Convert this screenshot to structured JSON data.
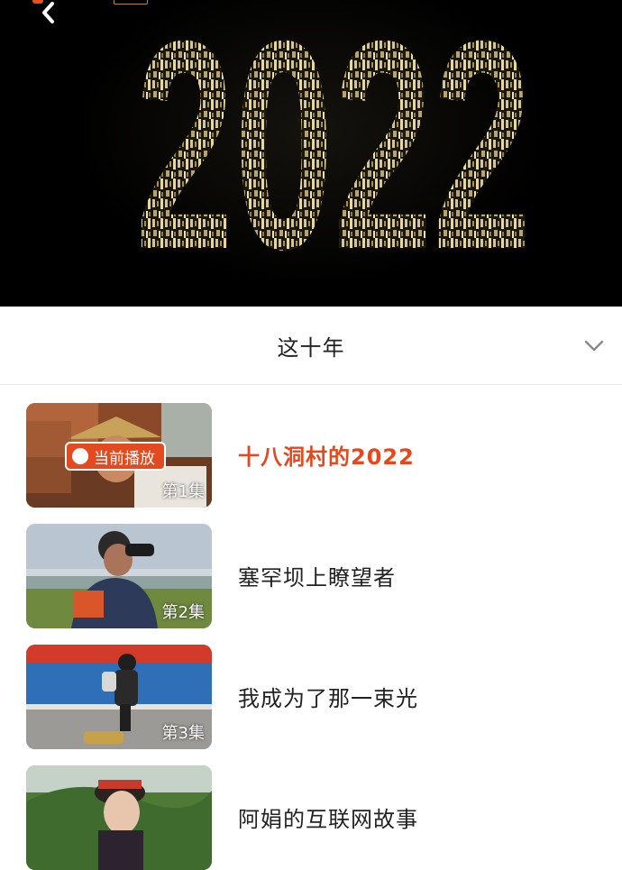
{
  "hero": {
    "year_text": "2022"
  },
  "section": {
    "title": "这十年"
  },
  "episodes": [
    {
      "thumb_label": "第1集",
      "title": "十八洞村的2022",
      "active": true,
      "badge": "当前播放"
    },
    {
      "thumb_label": "第2集",
      "title": "塞罕坝上瞭望者",
      "active": false
    },
    {
      "thumb_label": "第3集",
      "title": "我成为了那一束光",
      "active": false
    },
    {
      "thumb_label": "",
      "title": "阿娟的互联网故事",
      "active": false
    }
  ],
  "colors": {
    "accent": "#e4481c",
    "hero_bg": "#000000",
    "year_gold": "#c9b27a"
  },
  "icons": [
    "back-chevron-icon",
    "expand-chevron-down-icon",
    "play-icon"
  ]
}
